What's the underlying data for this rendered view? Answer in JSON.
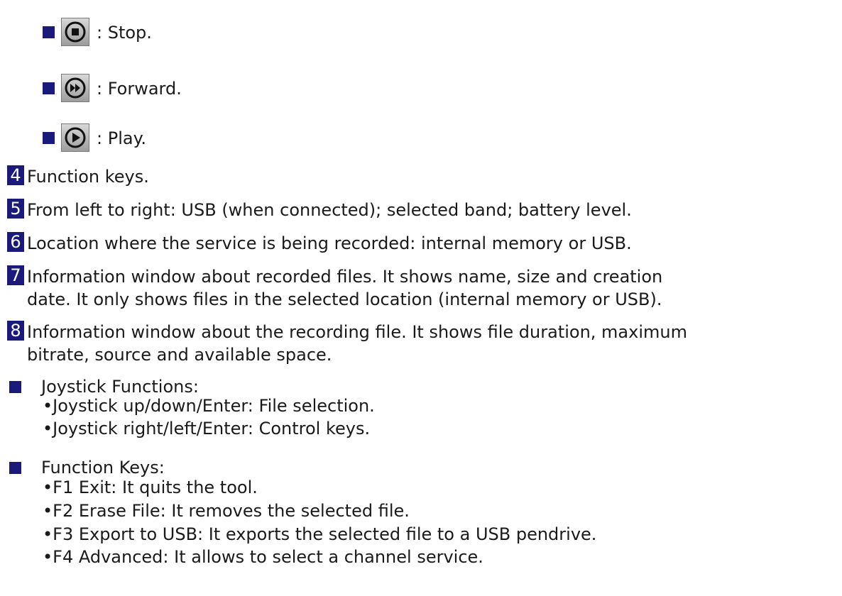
{
  "colors": {
    "bullet": "#1a1a7a",
    "text": "#1a1a1a",
    "button_gradient_top": "#d8d8d8",
    "button_gradient_bottom": "#9d9d9d"
  },
  "control_keys": [
    {
      "icon": "stop-icon",
      "text": ": Stop."
    },
    {
      "icon": "forward-icon",
      "text": ": Forward."
    },
    {
      "icon": "play-icon",
      "text": ": Play."
    }
  ],
  "numbered_items": [
    {
      "num": "4",
      "lines": [
        "Function keys."
      ]
    },
    {
      "num": "5",
      "lines": [
        "From left to right: USB (when connected); selected band; battery level."
      ]
    },
    {
      "num": "6",
      "lines": [
        "Location where the service is being recorded: internal memory or USB."
      ]
    },
    {
      "num": "7",
      "lines": [
        "Information window about recorded files. It shows name, size and creation",
        "date. It only shows files in the selected location (internal memory or USB)."
      ]
    },
    {
      "num": "8",
      "lines": [
        "Information window about the recording file. It shows file duration, maximum",
        "bitrate, source and available space."
      ]
    }
  ],
  "joystick": {
    "title": "Joystick Functions:",
    "items": [
      "•Joystick up/down/Enter: File selection.",
      "•Joystick right/left/Enter: Control keys."
    ]
  },
  "function_keys": {
    "title": "Function Keys:",
    "items": [
      "•F1 Exit: It quits the tool.",
      "•F2 Erase File: It removes the selected file.",
      "•F3 Export to USB: It exports the selected file to a USB pendrive.",
      "•F4 Advanced: It allows to select a channel service."
    ]
  }
}
